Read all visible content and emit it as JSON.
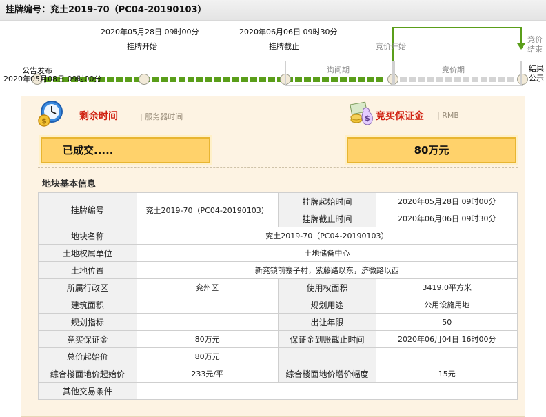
{
  "header": {
    "title": "挂牌编号：兖土2019-70（PC04-20190103）"
  },
  "timeline": {
    "announce_label": "公告发布",
    "announce_time": "2020年05月08日 09时00分",
    "start_time": "2020年05月28日 09时00分",
    "start_label": "挂牌开始",
    "end_time": "2020年06月06日 09时30分",
    "end_label": "挂牌截止",
    "bid_start_label": "竞价开始",
    "bid_end_label_1": "竞价",
    "bid_end_label_2": "结束",
    "result_label_1": "结果",
    "result_label_2": "公示",
    "inquiry_period": "询问期",
    "bid_period": "竞价期"
  },
  "panel": {
    "remaining_time_label": "剩余时间",
    "server_time_label": "| 服务器时间",
    "status": "已成交.....",
    "deposit_label": "竞买保证金",
    "currency_label": "| RMB",
    "deposit_amount": "80万元",
    "section_title": "地块基本信息"
  },
  "table": {
    "listing_no_label": "挂牌编号",
    "listing_no": "兖土2019-70（PC04-20190103）",
    "start_time_label": "挂牌起始时间",
    "start_time": "2020年05月28日 09时00分",
    "end_time_label": "挂牌截止时间",
    "end_time": "2020年06月06日 09时30分",
    "parcel_name_label": "地块名称",
    "parcel_name": "兖土2019-70（PC04-20190103）",
    "owner_label": "土地权属单位",
    "owner": "土地储备中心",
    "location_label": "土地位置",
    "location": "新兖镇前寨子村，紫藤路以东，济微路以西",
    "district_label": "所属行政区",
    "district": "兖州区",
    "use_area_label": "使用权面积",
    "use_area": "3419.0平方米",
    "building_area_label": "建筑面积",
    "building_area": "",
    "plan_use_label": "规划用途",
    "plan_use": "公用设施用地",
    "plan_index_label": "规划指标",
    "plan_index": "",
    "lease_term_label": "出让年限",
    "lease_term": "50",
    "deposit_label": "竞买保证金",
    "deposit": "80万元",
    "deposit_deadline_label": "保证金到账截止时间",
    "deposit_deadline": "2020年06月04日 16时00分",
    "total_start_price_label": "总价起始价",
    "total_start_price": "80万元",
    "floor_price_label": "综合楼面地价起始价",
    "floor_price": "233元/平",
    "floor_increment_label": "综合楼面地价增价幅度",
    "floor_increment": "15元",
    "other_conditions_label": "其他交易条件",
    "other_conditions": ""
  },
  "colors": {
    "accent_green": "#5a9e1a",
    "status_red": "#d02010",
    "box_yellow": "#ffd26b"
  }
}
